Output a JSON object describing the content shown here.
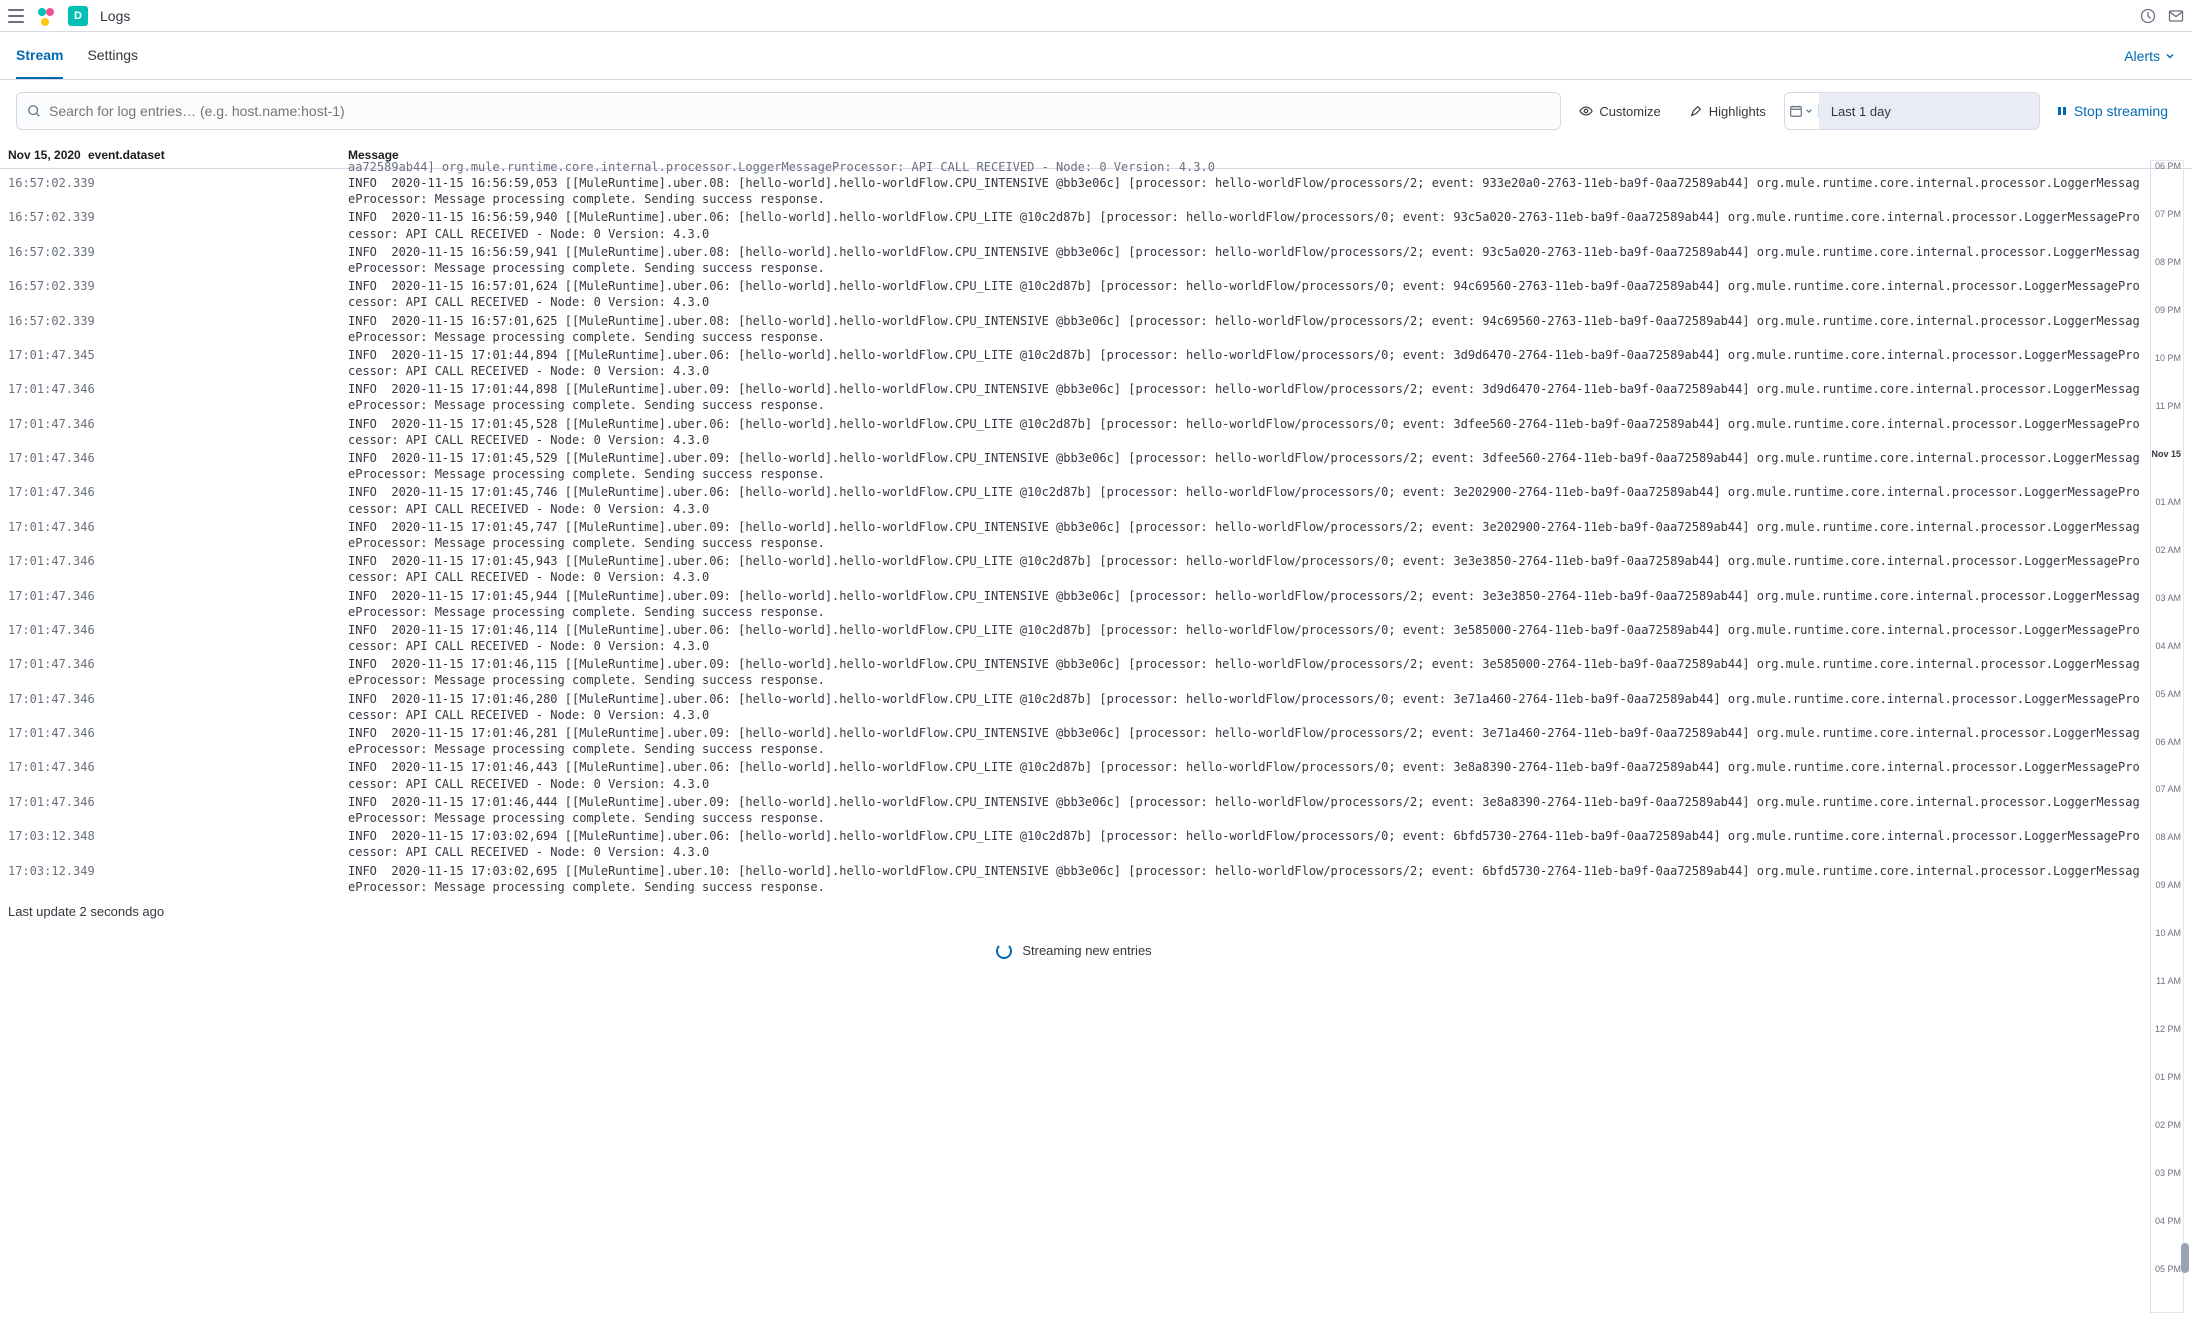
{
  "topbar": {
    "title": "Logs",
    "app_letter": "D"
  },
  "tabs": {
    "stream": "Stream",
    "settings": "Settings",
    "alerts": "Alerts"
  },
  "search": {
    "placeholder": "Search for log entries… (e.g. host.name:host-1)"
  },
  "controls": {
    "customize": "Customize",
    "highlights": "Highlights",
    "date": "Last 1 day",
    "stop": "Stop streaming"
  },
  "columns": {
    "ts": "Nov 15, 2020",
    "dataset": "event.dataset",
    "message": "Message"
  },
  "footer": {
    "update": "Last update 2 seconds ago",
    "streaming": "Streaming new entries"
  },
  "cutoff_line": "aa72589ab44] org.mule.runtime.core.internal.processor.LoggerMessageProcessor: API CALL RECEIVED - Node: 0 Version: 4.3.0",
  "rows": [
    {
      "ts": "16:57:02.339",
      "msg": "INFO  2020-11-15 16:56:59,053 [[MuleRuntime].uber.08: [hello-world].hello-worldFlow.CPU_INTENSIVE @bb3e06c] [processor: hello-worldFlow/processors/2; event: 933e20a0-2763-11eb-ba9f-0aa72589ab44] org.mule.runtime.core.internal.processor.LoggerMessageProcessor: Message processing complete. Sending success response."
    },
    {
      "ts": "16:57:02.339",
      "msg": "INFO  2020-11-15 16:56:59,940 [[MuleRuntime].uber.06: [hello-world].hello-worldFlow.CPU_LITE @10c2d87b] [processor: hello-worldFlow/processors/0; event: 93c5a020-2763-11eb-ba9f-0aa72589ab44] org.mule.runtime.core.internal.processor.LoggerMessageProcessor: API CALL RECEIVED - Node: 0 Version: 4.3.0"
    },
    {
      "ts": "16:57:02.339",
      "msg": "INFO  2020-11-15 16:56:59,941 [[MuleRuntime].uber.08: [hello-world].hello-worldFlow.CPU_INTENSIVE @bb3e06c] [processor: hello-worldFlow/processors/2; event: 93c5a020-2763-11eb-ba9f-0aa72589ab44] org.mule.runtime.core.internal.processor.LoggerMessageProcessor: Message processing complete. Sending success response."
    },
    {
      "ts": "16:57:02.339",
      "msg": "INFO  2020-11-15 16:57:01,624 [[MuleRuntime].uber.06: [hello-world].hello-worldFlow.CPU_LITE @10c2d87b] [processor: hello-worldFlow/processors/0; event: 94c69560-2763-11eb-ba9f-0aa72589ab44] org.mule.runtime.core.internal.processor.LoggerMessageProcessor: API CALL RECEIVED - Node: 0 Version: 4.3.0"
    },
    {
      "ts": "16:57:02.339",
      "msg": "INFO  2020-11-15 16:57:01,625 [[MuleRuntime].uber.08: [hello-world].hello-worldFlow.CPU_INTENSIVE @bb3e06c] [processor: hello-worldFlow/processors/2; event: 94c69560-2763-11eb-ba9f-0aa72589ab44] org.mule.runtime.core.internal.processor.LoggerMessageProcessor: Message processing complete. Sending success response."
    },
    {
      "ts": "17:01:47.345",
      "msg": "INFO  2020-11-15 17:01:44,894 [[MuleRuntime].uber.06: [hello-world].hello-worldFlow.CPU_LITE @10c2d87b] [processor: hello-worldFlow/processors/0; event: 3d9d6470-2764-11eb-ba9f-0aa72589ab44] org.mule.runtime.core.internal.processor.LoggerMessageProcessor: API CALL RECEIVED - Node: 0 Version: 4.3.0"
    },
    {
      "ts": "17:01:47.346",
      "msg": "INFO  2020-11-15 17:01:44,898 [[MuleRuntime].uber.09: [hello-world].hello-worldFlow.CPU_INTENSIVE @bb3e06c] [processor: hello-worldFlow/processors/2; event: 3d9d6470-2764-11eb-ba9f-0aa72589ab44] org.mule.runtime.core.internal.processor.LoggerMessageProcessor: Message processing complete. Sending success response."
    },
    {
      "ts": "17:01:47.346",
      "msg": "INFO  2020-11-15 17:01:45,528 [[MuleRuntime].uber.06: [hello-world].hello-worldFlow.CPU_LITE @10c2d87b] [processor: hello-worldFlow/processors/0; event: 3dfee560-2764-11eb-ba9f-0aa72589ab44] org.mule.runtime.core.internal.processor.LoggerMessageProcessor: API CALL RECEIVED - Node: 0 Version: 4.3.0"
    },
    {
      "ts": "17:01:47.346",
      "msg": "INFO  2020-11-15 17:01:45,529 [[MuleRuntime].uber.09: [hello-world].hello-worldFlow.CPU_INTENSIVE @bb3e06c] [processor: hello-worldFlow/processors/2; event: 3dfee560-2764-11eb-ba9f-0aa72589ab44] org.mule.runtime.core.internal.processor.LoggerMessageProcessor: Message processing complete. Sending success response."
    },
    {
      "ts": "17:01:47.346",
      "msg": "INFO  2020-11-15 17:01:45,746 [[MuleRuntime].uber.06: [hello-world].hello-worldFlow.CPU_LITE @10c2d87b] [processor: hello-worldFlow/processors/0; event: 3e202900-2764-11eb-ba9f-0aa72589ab44] org.mule.runtime.core.internal.processor.LoggerMessageProcessor: API CALL RECEIVED - Node: 0 Version: 4.3.0"
    },
    {
      "ts": "17:01:47.346",
      "msg": "INFO  2020-11-15 17:01:45,747 [[MuleRuntime].uber.09: [hello-world].hello-worldFlow.CPU_INTENSIVE @bb3e06c] [processor: hello-worldFlow/processors/2; event: 3e202900-2764-11eb-ba9f-0aa72589ab44] org.mule.runtime.core.internal.processor.LoggerMessageProcessor: Message processing complete. Sending success response."
    },
    {
      "ts": "17:01:47.346",
      "msg": "INFO  2020-11-15 17:01:45,943 [[MuleRuntime].uber.06: [hello-world].hello-worldFlow.CPU_LITE @10c2d87b] [processor: hello-worldFlow/processors/0; event: 3e3e3850-2764-11eb-ba9f-0aa72589ab44] org.mule.runtime.core.internal.processor.LoggerMessageProcessor: API CALL RECEIVED - Node: 0 Version: 4.3.0"
    },
    {
      "ts": "17:01:47.346",
      "msg": "INFO  2020-11-15 17:01:45,944 [[MuleRuntime].uber.09: [hello-world].hello-worldFlow.CPU_INTENSIVE @bb3e06c] [processor: hello-worldFlow/processors/2; event: 3e3e3850-2764-11eb-ba9f-0aa72589ab44] org.mule.runtime.core.internal.processor.LoggerMessageProcessor: Message processing complete. Sending success response."
    },
    {
      "ts": "17:01:47.346",
      "msg": "INFO  2020-11-15 17:01:46,114 [[MuleRuntime].uber.06: [hello-world].hello-worldFlow.CPU_LITE @10c2d87b] [processor: hello-worldFlow/processors/0; event: 3e585000-2764-11eb-ba9f-0aa72589ab44] org.mule.runtime.core.internal.processor.LoggerMessageProcessor: API CALL RECEIVED - Node: 0 Version: 4.3.0"
    },
    {
      "ts": "17:01:47.346",
      "msg": "INFO  2020-11-15 17:01:46,115 [[MuleRuntime].uber.09: [hello-world].hello-worldFlow.CPU_INTENSIVE @bb3e06c] [processor: hello-worldFlow/processors/2; event: 3e585000-2764-11eb-ba9f-0aa72589ab44] org.mule.runtime.core.internal.processor.LoggerMessageProcessor: Message processing complete. Sending success response."
    },
    {
      "ts": "17:01:47.346",
      "msg": "INFO  2020-11-15 17:01:46,280 [[MuleRuntime].uber.06: [hello-world].hello-worldFlow.CPU_LITE @10c2d87b] [processor: hello-worldFlow/processors/0; event: 3e71a460-2764-11eb-ba9f-0aa72589ab44] org.mule.runtime.core.internal.processor.LoggerMessageProcessor: API CALL RECEIVED - Node: 0 Version: 4.3.0"
    },
    {
      "ts": "17:01:47.346",
      "msg": "INFO  2020-11-15 17:01:46,281 [[MuleRuntime].uber.09: [hello-world].hello-worldFlow.CPU_INTENSIVE @bb3e06c] [processor: hello-worldFlow/processors/2; event: 3e71a460-2764-11eb-ba9f-0aa72589ab44] org.mule.runtime.core.internal.processor.LoggerMessageProcessor: Message processing complete. Sending success response."
    },
    {
      "ts": "17:01:47.346",
      "msg": "INFO  2020-11-15 17:01:46,443 [[MuleRuntime].uber.06: [hello-world].hello-worldFlow.CPU_LITE @10c2d87b] [processor: hello-worldFlow/processors/0; event: 3e8a8390-2764-11eb-ba9f-0aa72589ab44] org.mule.runtime.core.internal.processor.LoggerMessageProcessor: API CALL RECEIVED - Node: 0 Version: 4.3.0"
    },
    {
      "ts": "17:01:47.346",
      "msg": "INFO  2020-11-15 17:01:46,444 [[MuleRuntime].uber.09: [hello-world].hello-worldFlow.CPU_INTENSIVE @bb3e06c] [processor: hello-worldFlow/processors/2; event: 3e8a8390-2764-11eb-ba9f-0aa72589ab44] org.mule.runtime.core.internal.processor.LoggerMessageProcessor: Message processing complete. Sending success response."
    },
    {
      "ts": "17:03:12.348",
      "msg": "INFO  2020-11-15 17:03:02,694 [[MuleRuntime].uber.06: [hello-world].hello-worldFlow.CPU_LITE @10c2d87b] [processor: hello-worldFlow/processors/0; event: 6bfd5730-2764-11eb-ba9f-0aa72589ab44] org.mule.runtime.core.internal.processor.LoggerMessageProcessor: API CALL RECEIVED - Node: 0 Version: 4.3.0"
    },
    {
      "ts": "17:03:12.349",
      "msg": "INFO  2020-11-15 17:03:02,695 [[MuleRuntime].uber.10: [hello-world].hello-worldFlow.CPU_INTENSIVE @bb3e06c] [processor: hello-worldFlow/processors/2; event: 6bfd5730-2764-11eb-ba9f-0aa72589ab44] org.mule.runtime.core.internal.processor.LoggerMessageProcessor: Message processing complete. Sending success response."
    }
  ],
  "minimap": {
    "ticks": [
      "06 PM",
      "07 PM",
      "08 PM",
      "09 PM",
      "10 PM",
      "11 PM",
      "Nov 15",
      "01 AM",
      "02 AM",
      "03 AM",
      "04 AM",
      "05 AM",
      "06 AM",
      "07 AM",
      "08 AM",
      "09 AM",
      "10 AM",
      "11 AM",
      "12 PM",
      "01 PM",
      "02 PM",
      "03 PM",
      "04 PM",
      "05 PM"
    ]
  }
}
